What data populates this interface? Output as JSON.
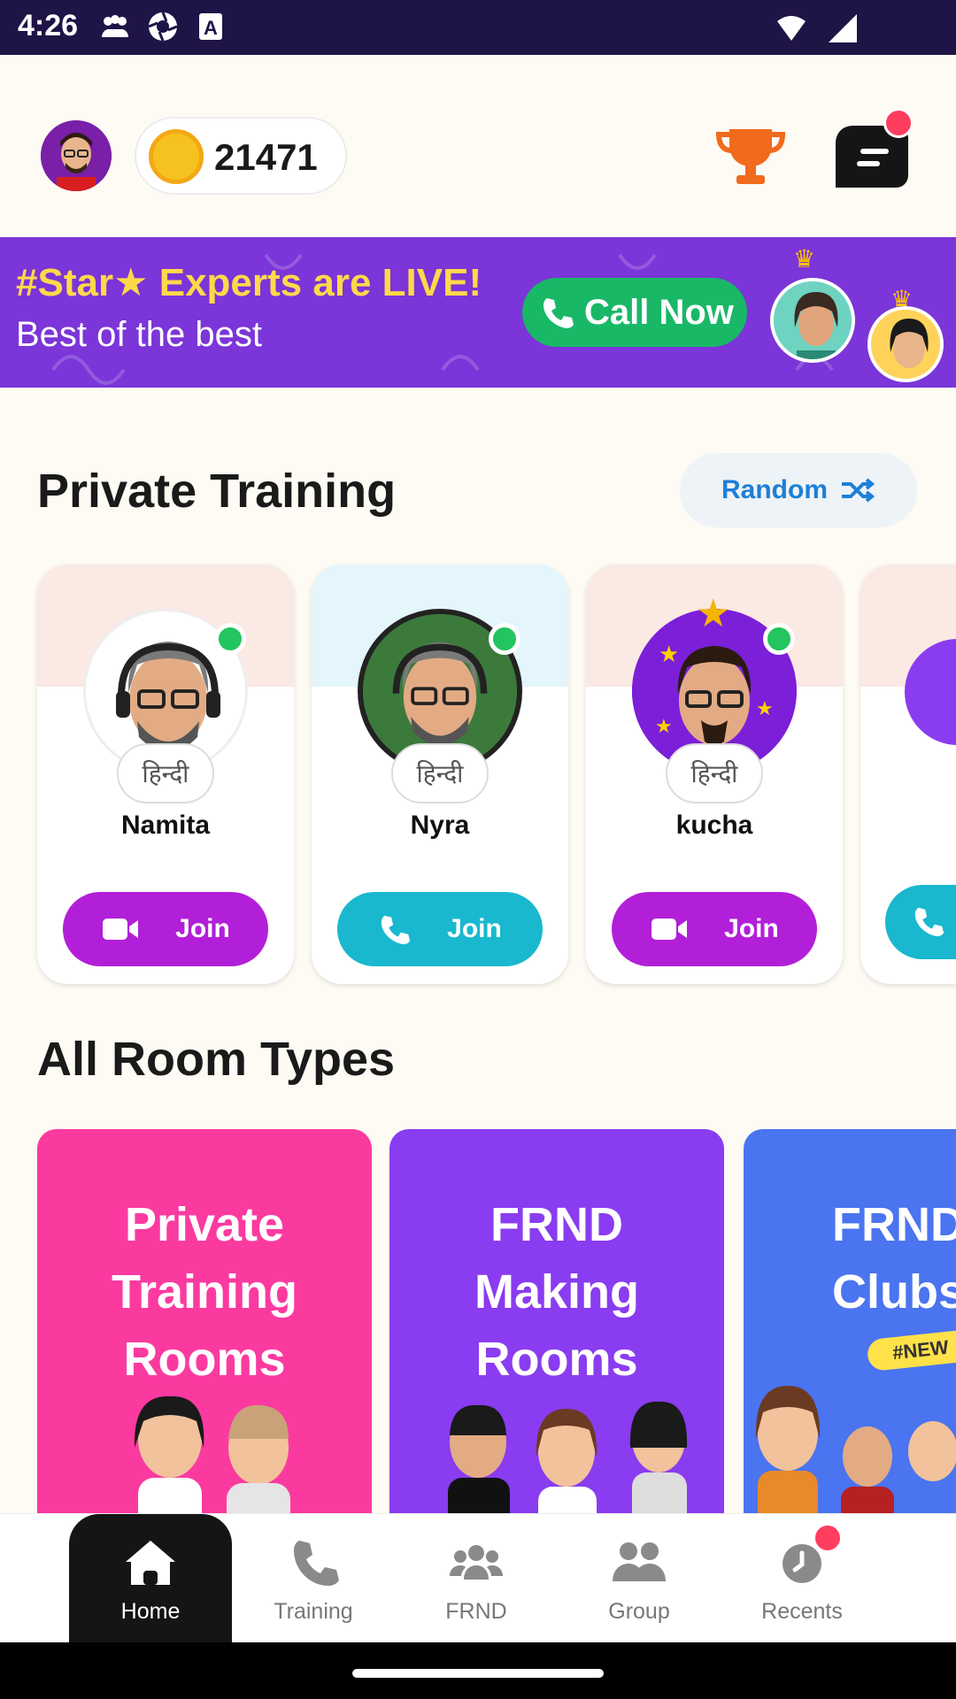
{
  "status_bar": {
    "time": "4:26",
    "icons": [
      "people-icon",
      "aperture-icon",
      "a-icon",
      "wifi-icon",
      "signal-icon"
    ]
  },
  "header": {
    "coins": "21471",
    "icons": [
      "avatar",
      "coin-icon",
      "trophy-icon",
      "chat-icon"
    ]
  },
  "banner": {
    "title": "#Star★ Experts are LIVE!",
    "subtitle": "Best of the best",
    "call_label": "Call Now"
  },
  "private_training": {
    "title": "Private Training",
    "random_label": "Random",
    "cards": [
      {
        "name": "Namita",
        "language": "हिन्दी",
        "join_label": "Join",
        "call_type": "video",
        "online": true
      },
      {
        "name": "Nyra",
        "language": "हिन्दी",
        "join_label": "Join",
        "call_type": "audio",
        "online": true
      },
      {
        "name": "kucha",
        "language": "हिन्दी",
        "join_label": "Join",
        "call_type": "video",
        "online": true
      }
    ]
  },
  "room_types": {
    "title": "All Room Types",
    "rooms": [
      {
        "title": "Private\nTraining\nRooms",
        "color": "#fb3aa0"
      },
      {
        "title": "FRND\nMaking\nRooms",
        "color": "#8a3cf0"
      },
      {
        "title": "FRND\nClubs",
        "color": "#4a74f0",
        "badge": "#NEW"
      }
    ]
  },
  "bottom_nav": {
    "items": [
      {
        "label": "Home",
        "icon": "home-icon",
        "active": true
      },
      {
        "label": "Training",
        "icon": "phone-icon",
        "active": false
      },
      {
        "label": "FRND",
        "icon": "friends-icon",
        "active": false
      },
      {
        "label": "Group",
        "icon": "group-icon",
        "active": false
      },
      {
        "label": "Recents",
        "icon": "clock-icon",
        "active": false
      }
    ]
  },
  "colors": {
    "status_bar": "#1f1446",
    "banner": "#7b35d8",
    "call_now": "#18b867",
    "join_video": "#b21fd8",
    "join_audio": "#19b8cf",
    "random_text": "#1e7fd6",
    "notification": "#ff3d5e"
  }
}
